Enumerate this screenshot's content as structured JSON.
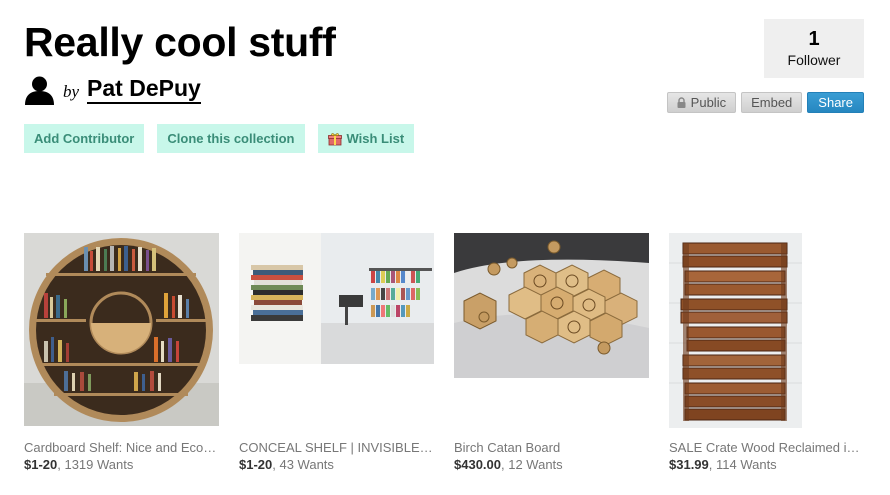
{
  "collection": {
    "title": "Really cool stuff",
    "by_label": "by",
    "owner_name": "Pat DePuy"
  },
  "actions": {
    "add_contributor": "Add Contributor",
    "clone": "Clone this collection",
    "wish_list": "Wish List"
  },
  "followers": {
    "count": "1",
    "label": "Follower"
  },
  "share_bar": {
    "public": "Public",
    "embed": "Embed",
    "share": "Share"
  },
  "items": [
    {
      "caption": "Cardboard Shelf: Nice and Eco-Friendly",
      "price": "$1-20",
      "wants": ", 1319 Wants"
    },
    {
      "caption": "CONCEAL SHELF | INVISIBLE BOOKSHELF",
      "price": "$1-20",
      "wants": ", 43 Wants"
    },
    {
      "caption": "Birch Catan Board",
      "price": "$430.00",
      "wants": ", 12 Wants"
    },
    {
      "caption": "SALE Crate Wood Reclaimed industrial crates",
      "price": "$31.99",
      "wants": ", 114 Wants"
    }
  ],
  "colors": {
    "action_bg": "#c8f7ea",
    "action_text": "#3a8d78",
    "share_blue": "#2687c0",
    "follower_bg": "#efefef"
  }
}
